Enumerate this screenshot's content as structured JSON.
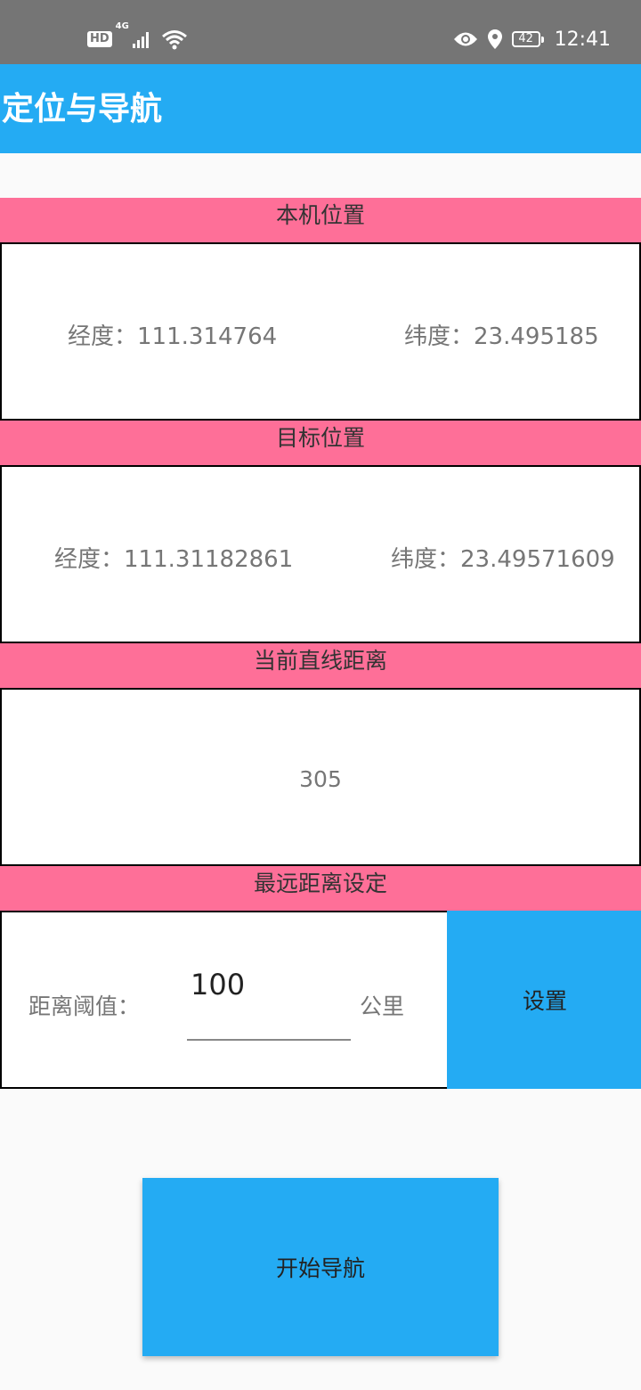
{
  "status_bar": {
    "hd_label": "HD",
    "network_label": "4G",
    "battery_level": "42",
    "time": "12:41",
    "icons": [
      "signal-icon",
      "wifi-icon",
      "eye-icon",
      "location-icon",
      "battery-icon"
    ]
  },
  "app_bar": {
    "title": "定位与导航"
  },
  "local_position": {
    "header": "本机位置",
    "longitude_label": "经度：",
    "longitude": "111.314764",
    "latitude_label": "纬度：",
    "latitude": "23.495185"
  },
  "target_position": {
    "header": "目标位置",
    "longitude_label": "经度：",
    "longitude": "111.31182861",
    "latitude_label": "纬度：",
    "latitude": "23.49571609"
  },
  "current_distance": {
    "header": "当前直线距离",
    "value": "305"
  },
  "max_distance": {
    "header": "最远距离设定",
    "threshold_label": "距离阈值：",
    "threshold_value": "100",
    "unit": "公里",
    "set_button": "设置"
  },
  "start_nav_button": "开始导航",
  "colors": {
    "app_bar": "#24abf3",
    "section_header": "#fe6f98",
    "button": "#24abf3",
    "status_bar": "#757575"
  }
}
